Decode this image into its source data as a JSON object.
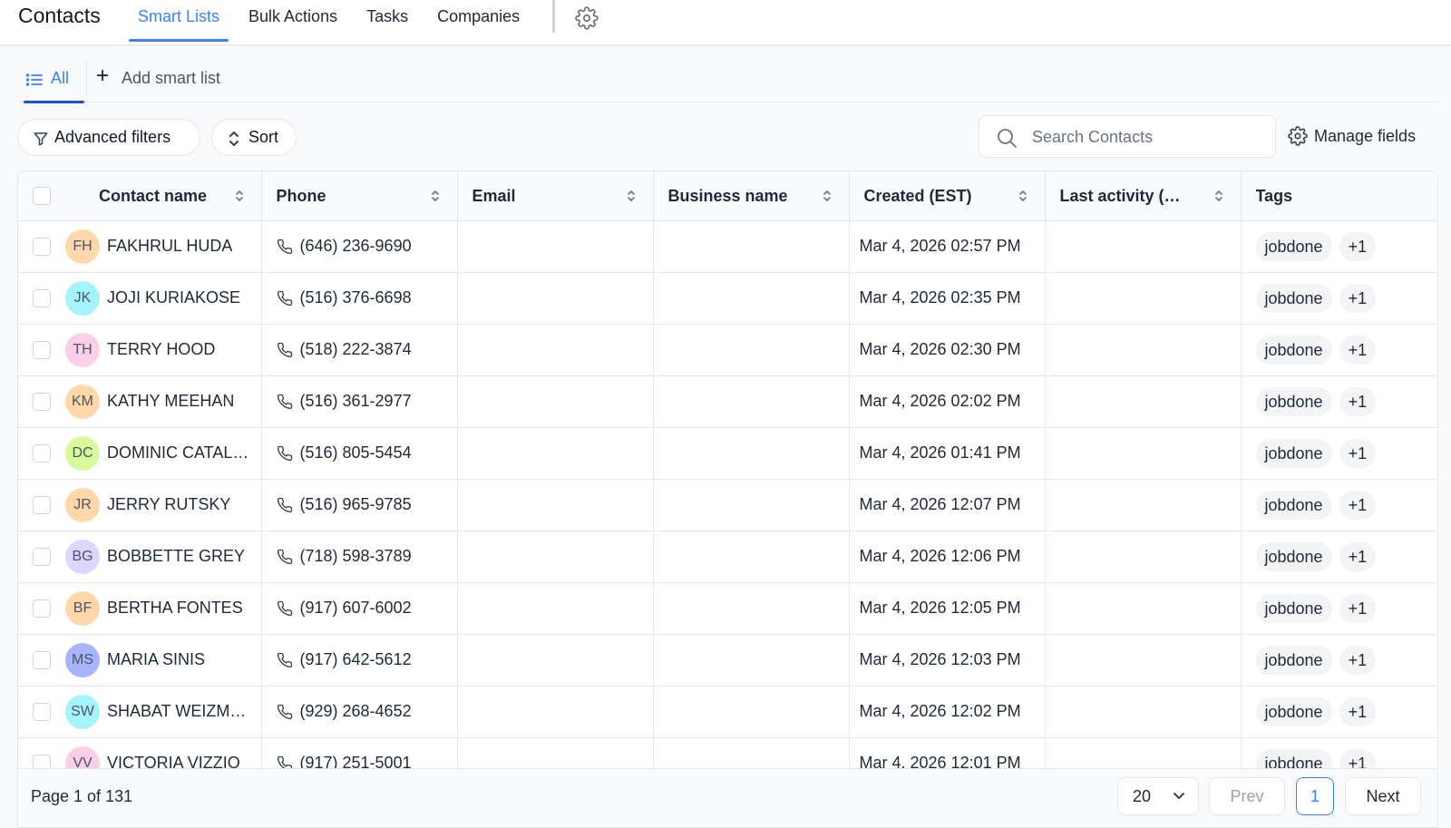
{
  "header": {
    "title": "Contacts",
    "tabs": [
      {
        "label": "Smart Lists",
        "active": true
      },
      {
        "label": "Bulk Actions",
        "active": false
      },
      {
        "label": "Tasks",
        "active": false
      },
      {
        "label": "Companies",
        "active": false
      }
    ],
    "settings_icon": "gear-icon"
  },
  "smart_lists": {
    "all_label": "All",
    "add_label": "Add smart list"
  },
  "toolbar": {
    "advanced_filters_label": "Advanced filters",
    "sort_label": "Sort",
    "search_placeholder": "Search Contacts",
    "manage_fields_label": "Manage fields"
  },
  "table": {
    "columns": [
      "Contact name",
      "Phone",
      "Email",
      "Business name",
      "Created (EST)",
      "Last activity (EST)",
      "Tags"
    ],
    "rows": [
      {
        "initials": "FH",
        "avatar_color": "#fed7aa",
        "name": "FAKHRUL HUDA",
        "phone": "(646) 236-9690",
        "email": "",
        "business": "",
        "created": "Mar 4, 2026 02:57 PM",
        "last_activity": "",
        "tag": "jobdone",
        "tag_more": "+1"
      },
      {
        "initials": "JK",
        "avatar_color": "#a5f3fc",
        "name": "JOJI KURIAKOSE",
        "phone": "(516) 376-6698",
        "email": "",
        "business": "",
        "created": "Mar 4, 2026 02:35 PM",
        "last_activity": "",
        "tag": "jobdone",
        "tag_more": "+1"
      },
      {
        "initials": "TH",
        "avatar_color": "#fbcfe8",
        "name": "TERRY HOOD",
        "phone": "(518) 222-3874",
        "email": "",
        "business": "",
        "created": "Mar 4, 2026 02:30 PM",
        "last_activity": "",
        "tag": "jobdone",
        "tag_more": "+1"
      },
      {
        "initials": "KM",
        "avatar_color": "#fed7aa",
        "name": "KATHY MEEHAN",
        "phone": "(516) 361-2977",
        "email": "",
        "business": "",
        "created": "Mar 4, 2026 02:02 PM",
        "last_activity": "",
        "tag": "jobdone",
        "tag_more": "+1"
      },
      {
        "initials": "DC",
        "avatar_color": "#d9f99d",
        "name": "DOMINIC CATALANO",
        "phone": "(516) 805-5454",
        "email": "",
        "business": "",
        "created": "Mar 4, 2026 01:41 PM",
        "last_activity": "",
        "tag": "jobdone",
        "tag_more": "+1"
      },
      {
        "initials": "JR",
        "avatar_color": "#fed7aa",
        "name": "JERRY RUTSKY",
        "phone": "(516) 965-9785",
        "email": "",
        "business": "",
        "created": "Mar 4, 2026 12:07 PM",
        "last_activity": "",
        "tag": "jobdone",
        "tag_more": "+1"
      },
      {
        "initials": "BG",
        "avatar_color": "#ddd6fe",
        "name": "BOBBETTE GREY",
        "phone": "(718) 598-3789",
        "email": "",
        "business": "",
        "created": "Mar 4, 2026 12:06 PM",
        "last_activity": "",
        "tag": "jobdone",
        "tag_more": "+1"
      },
      {
        "initials": "BF",
        "avatar_color": "#fed7aa",
        "name": "BERTHA FONTES",
        "phone": "(917) 607-6002",
        "email": "",
        "business": "",
        "created": "Mar 4, 2026 12:05 PM",
        "last_activity": "",
        "tag": "jobdone",
        "tag_more": "+1"
      },
      {
        "initials": "MS",
        "avatar_color": "#a5b4fc",
        "name": "MARIA SINIS",
        "phone": "(917) 642-5612",
        "email": "",
        "business": "",
        "created": "Mar 4, 2026 12:03 PM",
        "last_activity": "",
        "tag": "jobdone",
        "tag_more": "+1"
      },
      {
        "initials": "SW",
        "avatar_color": "#a5f3fc",
        "name": "SHABAT WEIZMAN",
        "phone": "(929) 268-4652",
        "email": "",
        "business": "",
        "created": "Mar 4, 2026 12:02 PM",
        "last_activity": "",
        "tag": "jobdone",
        "tag_more": "+1"
      },
      {
        "initials": "VV",
        "avatar_color": "#fbcfe8",
        "name": "VICTORIA VIZZIO",
        "phone": "(917) 251-5001",
        "email": "",
        "business": "",
        "created": "Mar 4, 2026 12:01 PM",
        "last_activity": "",
        "tag": "jobdone",
        "tag_more": "+1"
      }
    ]
  },
  "pagination": {
    "info": "Page 1 of 131",
    "per_page": "20",
    "prev_label": "Prev",
    "current_page": "1",
    "next_label": "Next"
  },
  "colors": {
    "accent": "#3b82f6",
    "tab_underline": "#1d4ed8"
  }
}
